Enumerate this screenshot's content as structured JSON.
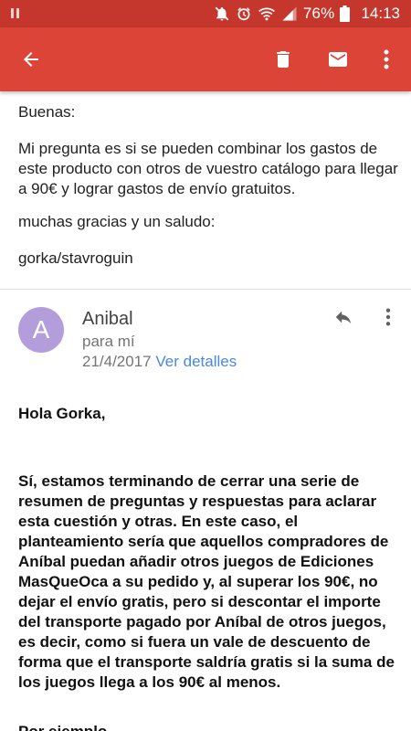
{
  "status_bar": {
    "battery": "76%",
    "time": "14:13",
    "icons": [
      "notification-icon",
      "mute-icon",
      "alarm-icon",
      "wifi-icon",
      "signal-icon",
      "battery-icon"
    ]
  },
  "app_bar": {
    "icons": [
      "back-arrow-icon",
      "delete-icon",
      "mail-icon",
      "more-vert-icon"
    ],
    "background": "#db4437",
    "status_background": "#c5372c"
  },
  "previous_message": {
    "greeting": "Buenas:",
    "body": "Mi pregunta es si se pueden combinar los gastos de este producto con otros de vuestro catálogo para llegar a 90€ y lograr gastos de envío gratuitos.",
    "thanks": "muchas gracias y un saludo:",
    "signature": "gorka/stavroguin"
  },
  "message": {
    "avatar_letter": "A",
    "avatar_color": "#b39ddb",
    "sender": "Anibal",
    "recipient": "para mí",
    "date": "21/4/2017",
    "details_link": "Ver detalles",
    "link_color": "#4a86e8",
    "greeting": "Hola Gorka,",
    "body": "Sí, estamos terminando de cerrar una serie de resumen de preguntas y respuestas para aclarar esta cuestión y otras. En este caso, el planteamiento sería que aquellos compradores de Aníbal puedan añadir otros juegos de Ediciones MasQueOca a su pedido y, al superar los 90€, no dejar el envío gratis, pero si descontar el importe del transporte pagado por Aníbal de otros juegos, es decir, como si fuera un vale de descuento de forma que el transporte saldría gratis si la suma de los juegos llega a los 90€ al menos.",
    "next_line": "Por ejemplo"
  }
}
